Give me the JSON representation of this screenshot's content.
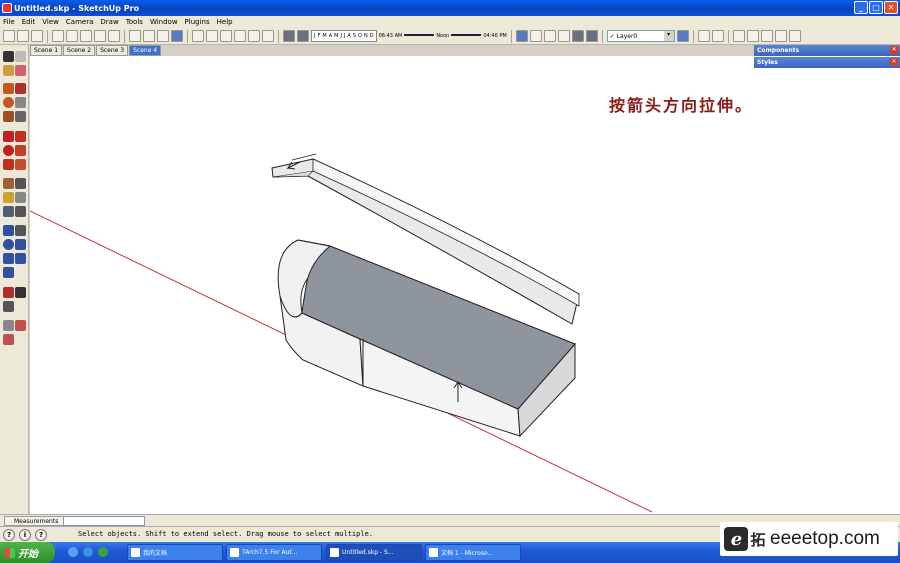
{
  "window": {
    "title": "Untitled.skp - SketchUp Pro",
    "controls": {
      "minimize": "_",
      "maximize": "□",
      "close": "✕"
    }
  },
  "menu": [
    "File",
    "Edit",
    "View",
    "Camera",
    "Draw",
    "Tools",
    "Window",
    "Plugins",
    "Help"
  ],
  "toolbar": {
    "months": [
      "J",
      "F",
      "M",
      "A",
      "M",
      "J",
      "J",
      "A",
      "S",
      "O",
      "N",
      "D"
    ],
    "time_start": "06:43 AM",
    "time_noon": "Noon",
    "time_end": "04:46 PM",
    "layer_check": "✓",
    "layer": "Layer0",
    "layer_dropdown": "▾"
  },
  "scene_tabs": [
    {
      "label": "Scene 1",
      "active": false
    },
    {
      "label": "Scene 2",
      "active": false
    },
    {
      "label": "Scene 3",
      "active": false
    },
    {
      "label": "Scene 4",
      "active": true
    }
  ],
  "panels": [
    {
      "title": "Components",
      "close": "✕"
    },
    {
      "title": "Styles",
      "close": "✕"
    }
  ],
  "annotation": "按箭头方向拉伸。",
  "measurements": {
    "label": "Measurements",
    "value": ""
  },
  "status": {
    "text": "Select objects. Shift to extend select. Drag mouse to select multiple.",
    "icons": [
      "?",
      "i",
      "?"
    ]
  },
  "taskbar": {
    "start": "开始",
    "tasks": [
      {
        "label": "我的文档",
        "active": false
      },
      {
        "label": "TArch7.5 For Aut...",
        "active": false
      },
      {
        "label": "Untitled.skp - S...",
        "active": true
      },
      {
        "label": "文档 1 - Microso...",
        "active": false
      }
    ]
  },
  "watermark": {
    "glyph_e": "e",
    "glyph_tuo": "拓",
    "text": "eeeetop.com"
  },
  "colors": {
    "title_bar": "#0a52d8",
    "annotation": "#8b1a1a",
    "axis_red": "#c0393b",
    "face_gray": "#8e959c",
    "face_white": "#f2f2f2"
  }
}
